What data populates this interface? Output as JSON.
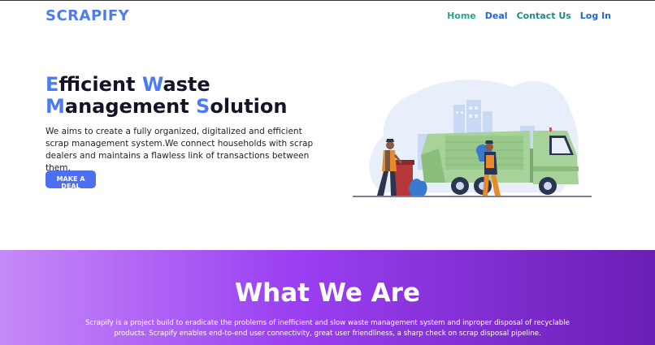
{
  "brand": {
    "name": "SCRAPIFY"
  },
  "nav": {
    "items": [
      {
        "label": "Home"
      },
      {
        "label": "Deal"
      },
      {
        "label": "Contact Us"
      },
      {
        "label": "Log In"
      }
    ]
  },
  "hero": {
    "title_line1": {
      "cap1": "E",
      "rest1": "fficient ",
      "cap2": "W",
      "rest2": "aste"
    },
    "title_line2": {
      "cap1": "M",
      "rest1": "anagement ",
      "cap2": "S",
      "rest2": "olution"
    },
    "description": "We aims to create a fully organized, digitalized and efficient scrap management system.We connect households with scrap dealers and maintains a flawless link of transactions between them.",
    "cta_label": "MAKE A DEAL"
  },
  "about": {
    "title": "What We Are",
    "description": "Scrapify is a project build to eradicate the problems of inefficient and slow waste management system and inproper disposal of recyclable products. Scrapify enables end-to-end user connectivity, great user friendliness, a sharp check on scrap disposal pipeline."
  },
  "colors": {
    "brand": "#4d7cf0",
    "cta": "#4d6ff0",
    "truck": "#a7d39a",
    "section_gradient_start": "#c58af7",
    "section_gradient_end": "#6a1fb4"
  }
}
